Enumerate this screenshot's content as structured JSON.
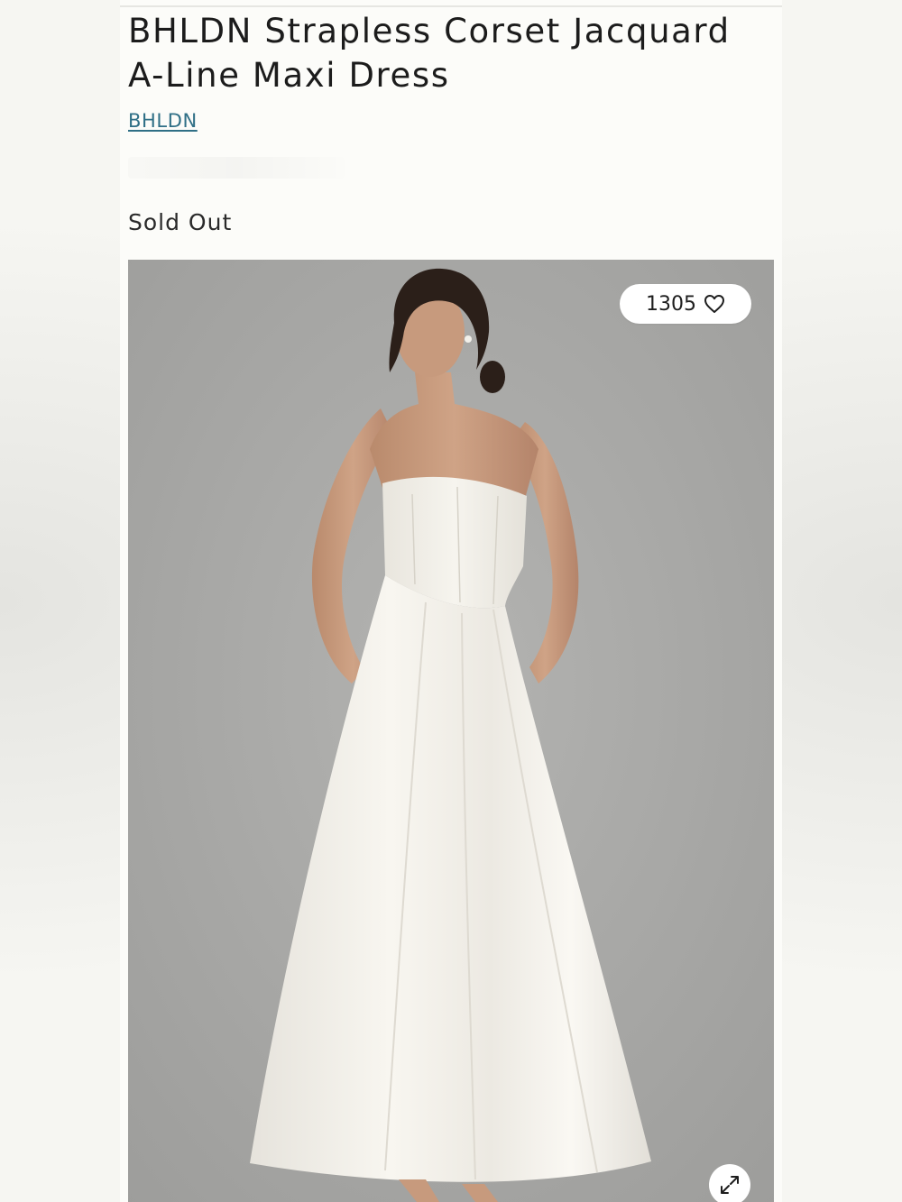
{
  "product": {
    "title": "BHLDN Strapless Corset Jacquard A-Line Maxi Dress",
    "brand_link": "BHLDN",
    "stock_status": "Sold Out"
  },
  "gallery": {
    "like_count": "1305",
    "like_icon": "heart-outline-icon",
    "expand_icon": "expand-arrows-icon"
  },
  "colors": {
    "brand_link": "#2f6f86",
    "photo_background": "#a7a7a5",
    "dress": "#f5f3ed"
  }
}
